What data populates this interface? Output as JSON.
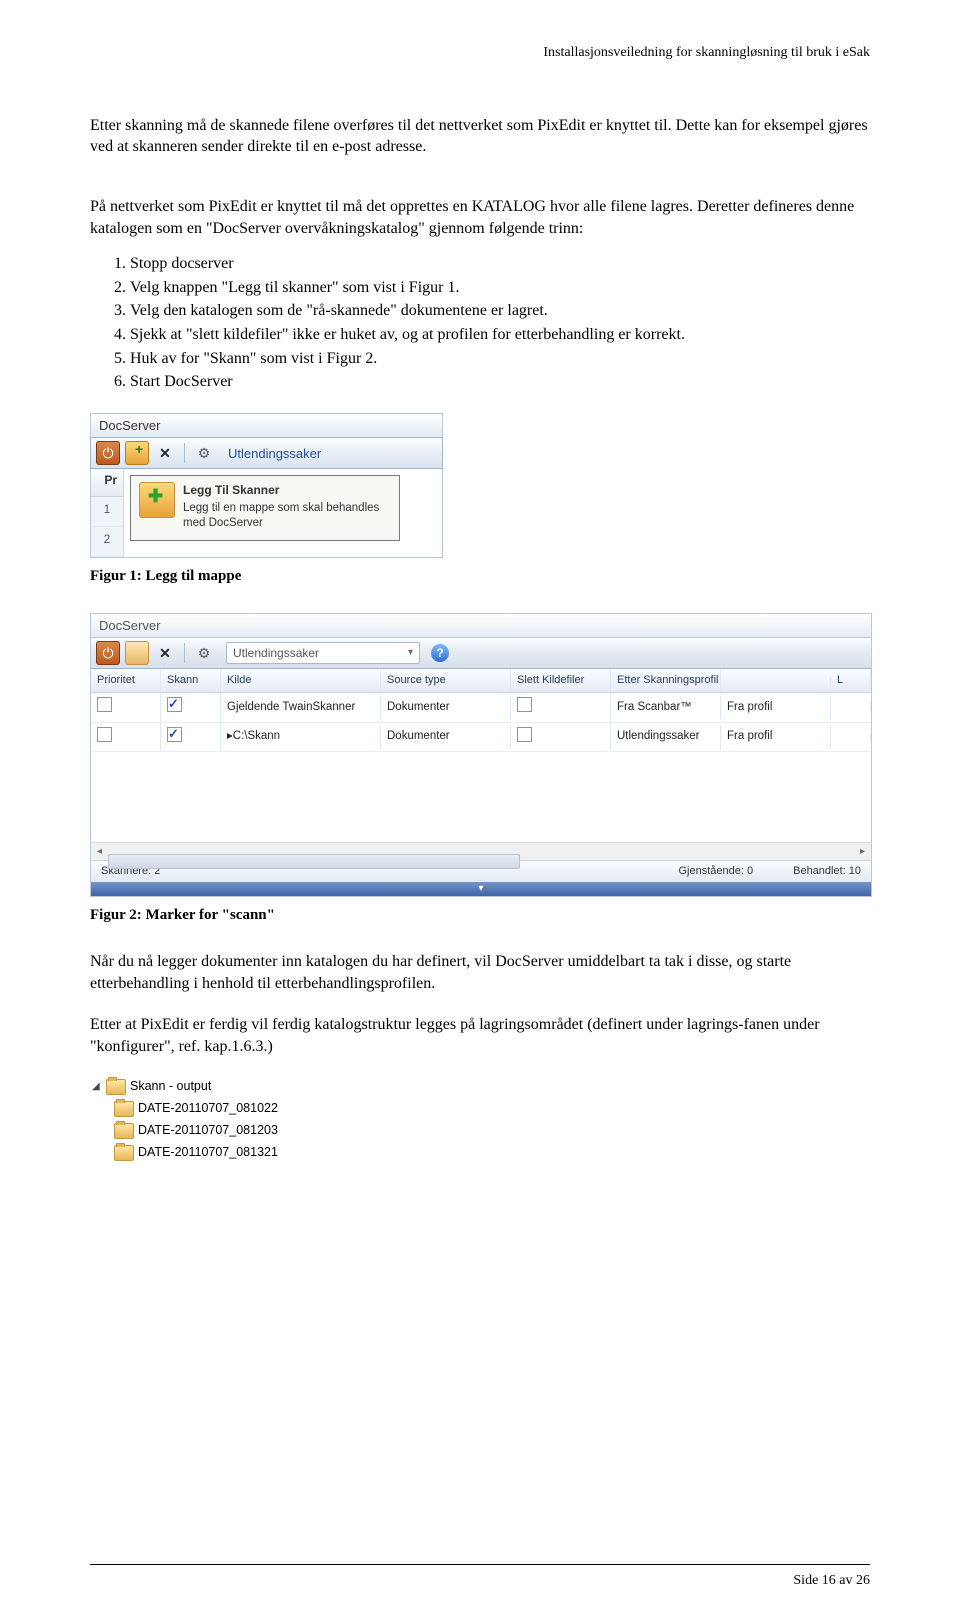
{
  "header": "Installasjonsveiledning for skanningløsning til bruk i eSak",
  "para1": "Etter skanning må de skannede filene overføres til det nettverket som PixEdit er knyttet til. Dette kan for eksempel gjøres ved at skanneren sender direkte til en e-post adresse.",
  "para2": "På nettverket som PixEdit er knyttet til må det opprettes en KATALOG hvor alle filene lagres. Deretter defineres denne katalogen som en \"DocServer overvåkningskatalog\" gjennom følgende trinn:",
  "steps": [
    "Stopp docserver",
    "Velg knappen \"Legg til skanner\" som vist i Figur 1.",
    "Velg den katalogen som de \"rå-skannede\" dokumentene er lagret.",
    "Sjekk at \"slett kildefiler\" ikke er huket av, og at profilen for etterbehandling er korrekt.",
    "Huk av for \"Skann\" som vist i Figur 2.",
    "Start DocServer"
  ],
  "docserver_small": {
    "title": "DocServer",
    "profile": "Utlendingssaker",
    "col_short": "Pr",
    "rows": [
      "1",
      "2"
    ],
    "tooltip_title": "Legg Til Skanner",
    "tooltip_body": "Legg til en mappe som skal behandles med DocServer"
  },
  "fig1_caption": "Figur 1: Legg til mappe",
  "docserver_wide": {
    "title": "DocServer",
    "profile": "Utlendingssaker",
    "columns": [
      "Prioritet",
      "Skann",
      "Kilde",
      "Source type",
      "Slett Kildefiler",
      "Etter Skanningsprofil",
      "",
      "L"
    ],
    "rows": [
      {
        "skann_checked": true,
        "kilde": "Gjeldende TwainSkanner",
        "stype": "Dokumenter",
        "slett_checked": false,
        "profil": "Fra Scanbar™",
        "last": "Fra profil"
      },
      {
        "skann_checked": true,
        "kilde": "▸C:\\Skann",
        "stype": "Dokumenter",
        "slett_checked": false,
        "profil": "Utlendingssaker",
        "last": "Fra profil"
      }
    ],
    "status_left": "Skannere: 2",
    "status_mid": "Gjenstående: 0",
    "status_right": "Behandlet: 10"
  },
  "fig2_caption": "Figur 2: Marker for \"scann\"",
  "para3": "Når du nå legger dokumenter inn katalogen du har definert, vil DocServer umiddelbart ta tak i disse, og starte etterbehandling i henhold til etterbehandlingsprofilen.",
  "para4": "Etter at PixEdit er ferdig vil ferdig katalogstruktur legges på lagringsområdet (definert under lagrings-fanen under \"konfigurer\", ref. kap.1.6.3.)",
  "folder_tree": {
    "root": "Skann - output",
    "children": [
      "DATE-20110707_081022",
      "DATE-20110707_081203",
      "DATE-20110707_081321"
    ]
  },
  "footer": "Side 16 av 26"
}
